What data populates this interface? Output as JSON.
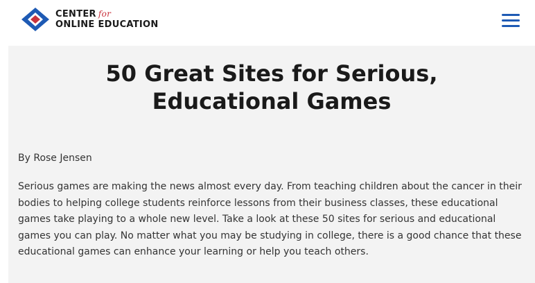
{
  "header": {
    "logo_line1": "CENTER",
    "logo_for": "for",
    "logo_line2": "ONLINE EDUCATION",
    "logo_icon": "diamond-logo-icon",
    "menu_icon": "hamburger-menu-icon",
    "brand_blue": "#1e5ab4",
    "brand_red": "#c8323c"
  },
  "article": {
    "title_line1": "50 Great Sites for Serious,",
    "title_line2": "Educational Games",
    "author": "By Rose Jensen",
    "body": "Serious games are making the news almost every day. From teaching children about the cancer in their bodies to helping college students reinforce lessons from their business classes, these educational games take playing to a whole new level. Take a look at these 50 sites for serious and educational games you can play. No matter what you may be studying in college, there is a good chance that these educational games can enhance your learning or help you teach others."
  }
}
